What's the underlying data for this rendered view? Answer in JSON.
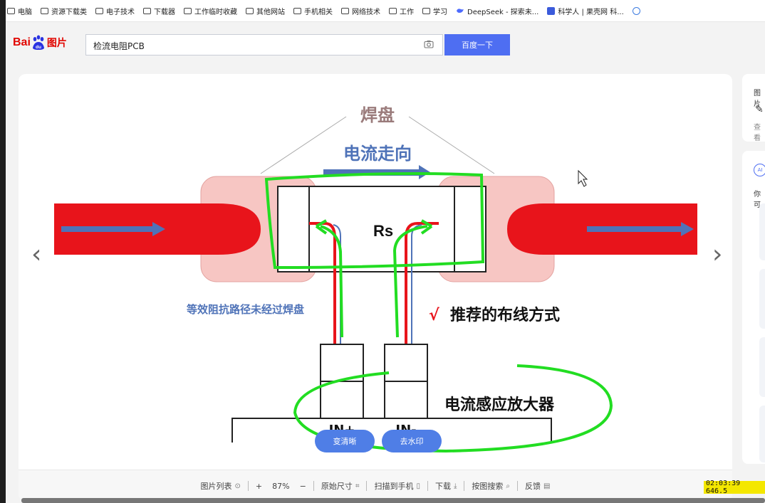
{
  "bookmarks": [
    {
      "label": "电脑",
      "icon": "folder-icon"
    },
    {
      "label": "资源下载类",
      "icon": "folder-icon"
    },
    {
      "label": "电子技术",
      "icon": "folder-icon"
    },
    {
      "label": "下载器",
      "icon": "folder-icon"
    },
    {
      "label": "工作临时收藏",
      "icon": "folder-icon"
    },
    {
      "label": "其他网站",
      "icon": "folder-icon"
    },
    {
      "label": "手机相关",
      "icon": "folder-icon"
    },
    {
      "label": "网络技术",
      "icon": "folder-icon"
    },
    {
      "label": "工作",
      "icon": "folder-icon"
    },
    {
      "label": "学习",
      "icon": "folder-icon"
    },
    {
      "label": "DeepSeek - 探索未...",
      "icon": "deepseek-icon"
    },
    {
      "label": "科学人 | 果壳网 科...",
      "icon": "guokr-icon"
    }
  ],
  "search": {
    "logo_text": "Bai",
    "logo_text2": "du",
    "logo_suffix": "图片",
    "query": "检流电阻PCB",
    "button_label": "百度一下"
  },
  "image": {
    "label_pad": "焊盘",
    "label_current_dir": "电流走向",
    "label_rs": "Rs",
    "label_bad_path": "等效阻抗路径未经过焊盘",
    "label_check": "√",
    "label_recommended": "推荐的布线方式",
    "label_amplifier": "电流感应放大器",
    "label_in_plus": "IN+",
    "label_in_minus": "IN-",
    "pill_sharpen": "变清晰",
    "pill_watermark": "去水印"
  },
  "toolbar": {
    "list": "图片列表",
    "zoom_in": "+",
    "zoom": "87%",
    "zoom_out": "−",
    "original": "原始尺寸",
    "scan": "扫描到手机",
    "download": "下载",
    "search_by_image": "按图搜索",
    "feedback": "反馈"
  },
  "side": {
    "t1": "图片",
    "t2": "查看",
    "t3": "你可"
  },
  "overlay": {
    "timestamp": "02:03:39  646.5"
  },
  "colors": {
    "baidu_red": "#e10601",
    "search_blue": "#4e6ef2",
    "trace_red": "#e8141b",
    "pad_pink": "#f7c6c3",
    "arrow_blue": "#4f73b8",
    "annotation_green": "#22dd22",
    "highlight_yellow": "#f4e700"
  }
}
